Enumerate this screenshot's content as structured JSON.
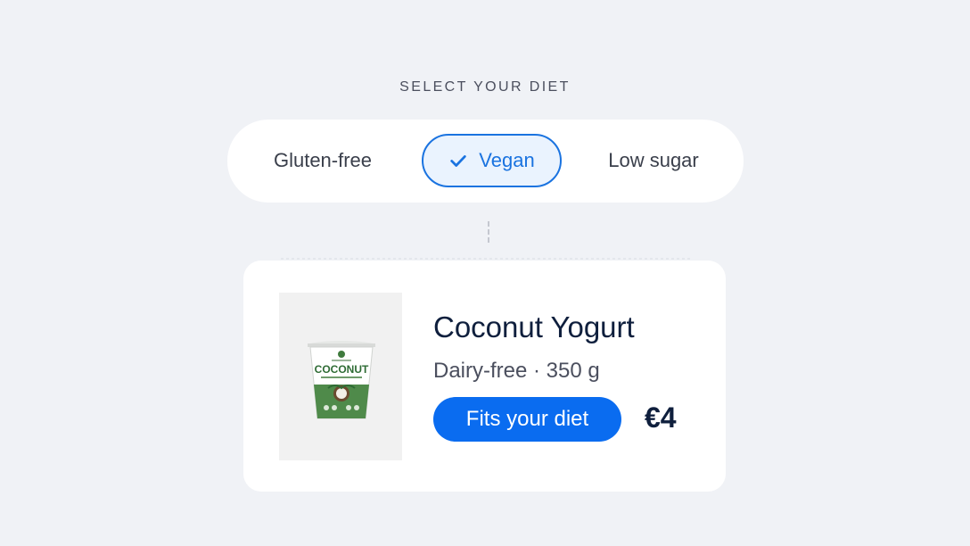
{
  "diet_selector": {
    "heading": "SELECT YOUR DIET",
    "options": [
      {
        "label": "Gluten-free",
        "selected": false
      },
      {
        "label": "Vegan",
        "selected": true
      },
      {
        "label": "Low sugar",
        "selected": false
      }
    ]
  },
  "product": {
    "name": "Coconut Yogurt",
    "details": "Dairy-free · 350 g",
    "badge": "Fits your diet",
    "price": "€4",
    "image": {
      "package_label": "COCONUT"
    }
  },
  "colors": {
    "accent": "#0a6cf0",
    "selected_border": "#1a73e0",
    "selected_bg": "#eaf3fe",
    "page_bg": "#f0f2f6",
    "text_dark": "#0f1f3d"
  }
}
